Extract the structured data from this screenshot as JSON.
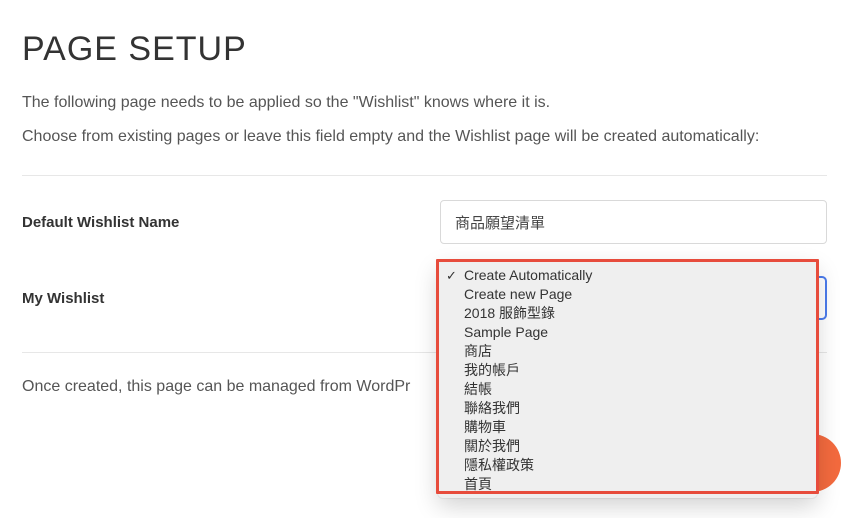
{
  "header": {
    "title": "PAGE SETUP",
    "intro_line1": "The following page needs to be applied so the \"Wishlist\" knows where it is.",
    "intro_line2": "Choose from existing pages or leave this field empty and the Wishlist page will be created automatically:"
  },
  "form": {
    "default_wishlist_label": "Default Wishlist Name",
    "default_wishlist_value": "商品願望清單",
    "my_wishlist_label": "My Wishlist",
    "my_wishlist_selected": "Create Automatically",
    "my_wishlist_options": [
      "Create Automatically",
      "Create new Page",
      "2018 服飾型錄",
      "Sample Page",
      "商店",
      "我的帳戶",
      "結帳",
      "聯絡我們",
      "購物車",
      "關於我們",
      "隱私權政策",
      "首頁"
    ]
  },
  "footer": {
    "note": "Once created, this page can be managed from WordPr"
  }
}
